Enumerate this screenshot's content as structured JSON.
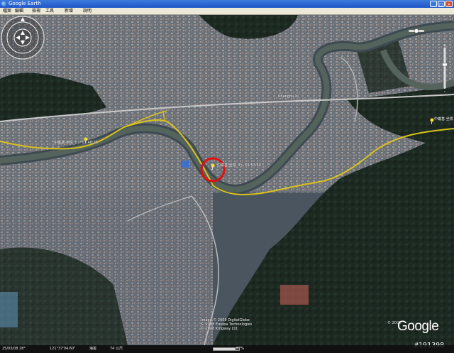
{
  "window": {
    "title": "Google Earth",
    "minimize_label": "_",
    "maximize_label": "□",
    "close_label": "×"
  },
  "menu": {
    "items": [
      "檔案",
      "編輯",
      "檢視",
      "工具",
      "新增",
      "說明"
    ]
  },
  "map": {
    "labels": {
      "place": "Changhu-lu",
      "marker_left": "中鐵基-坐標_1 ▷ 01:48:25",
      "marker_center": "中鐵基-坐標_3 ▷ 01:53:50",
      "marker_right": "中鐵基-坐標"
    },
    "copyright": [
      "Image © 2008 DigitalGlobe",
      "© 2008 Europa Technologies",
      "© 2008 Kingway Ltd."
    ],
    "logo_text": "Google",
    "logo_year": "© 2008",
    "watermark": "#191398",
    "colors": {
      "route": "#d9c21c",
      "highlight_circle": "#e01010"
    }
  },
  "statusbar": {
    "date": "25/03/08 28°",
    "coordinates": "121°37'04.60\"",
    "elevation_label": "海拔",
    "eye_alt": "74 公尺",
    "streaming_percent": "87%",
    "streaming_fraction": 0.87
  }
}
